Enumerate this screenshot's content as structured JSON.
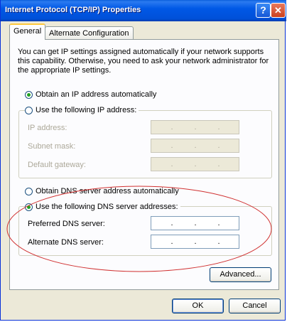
{
  "window": {
    "title": "Internet Protocol (TCP/IP) Properties",
    "help_glyph": "?",
    "close_glyph": "✕"
  },
  "tabs": [
    {
      "label": "General",
      "selected": true
    },
    {
      "label": "Alternate Configuration",
      "selected": false
    }
  ],
  "general": {
    "description": "You can get IP settings assigned automatically if your network supports this capability. Otherwise, you need to ask your network administrator for the appropriate IP settings.",
    "ip": {
      "auto_label": "Obtain an IP address automatically",
      "auto_checked": true,
      "manual_label": "Use the following IP address:",
      "manual_checked": false,
      "fields": [
        {
          "label": "IP address:",
          "value": ". . ."
        },
        {
          "label": "Subnet mask:",
          "value": ". . ."
        },
        {
          "label": "Default gateway:",
          "value": ". . ."
        }
      ]
    },
    "dns": {
      "auto_label": "Obtain DNS server address automatically",
      "auto_checked": false,
      "manual_label": "Use the following DNS server addresses:",
      "manual_checked": true,
      "fields": [
        {
          "label": "Preferred DNS server:",
          "value": ". . ."
        },
        {
          "label": "Alternate DNS server:",
          "value": ". . ."
        }
      ]
    },
    "advanced_label": "Advanced..."
  },
  "buttons": {
    "ok_label": "OK",
    "cancel_label": "Cancel"
  },
  "colors": {
    "title_bar": "#0058e6",
    "annotation_ellipse": "#d03030",
    "radio_dot": "#21a121"
  }
}
